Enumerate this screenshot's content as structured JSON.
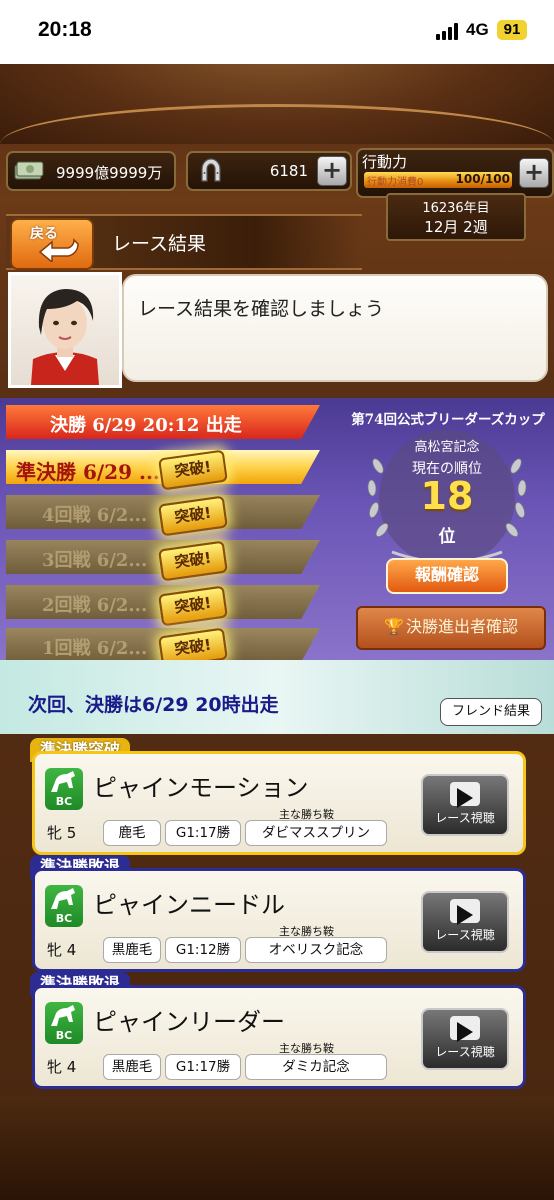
{
  "status": {
    "time": "20:18",
    "network": "4G",
    "battery": "91"
  },
  "resources": {
    "money": "9999億9999万",
    "horseshoe": "6181",
    "energy_label": "行動力",
    "energy_sub": "行動力消費0",
    "energy_value": "100/100"
  },
  "game_date": {
    "year": "16236年目",
    "week": "12月 2週"
  },
  "header": {
    "back_label": "戻る",
    "title": "レース結果"
  },
  "advisor": {
    "message": "レース結果を確認しましょう"
  },
  "tournament": {
    "rounds": [
      {
        "label": "決勝 6/29 20:12 出走",
        "state": "current"
      },
      {
        "label": "準決勝 6/29 ... 出走",
        "state": "cleared",
        "badge": "突破!"
      },
      {
        "label": "4回戦 6/2...",
        "state": "cleared",
        "badge": "突破!"
      },
      {
        "label": "3回戦 6/2...",
        "state": "cleared",
        "badge": "突破!"
      },
      {
        "label": "2回戦 6/2...",
        "state": "cleared",
        "badge": "突破!"
      },
      {
        "label": "1回戦 6/2...",
        "state": "cleared",
        "badge": "突破!"
      }
    ],
    "cup_title": "第74回公式ブリーダーズカップ",
    "cup_name": "高松宮記念",
    "rank_label": "現在の順位",
    "rank": "18",
    "rank_unit": "位",
    "reward_button": "報酬確認",
    "finalist_button": "決勝進出者確認"
  },
  "next_race": {
    "text": "次回、決勝は6/29 20時出走",
    "friend_button": "フレンド結果"
  },
  "horses": [
    {
      "status": "準決勝突破",
      "name": "ピャインモーション",
      "sex": "牝",
      "age": "5",
      "coat": "鹿毛",
      "record": "G1:17勝",
      "wins_label": "主な勝ち鞍",
      "main_win": "ダビマススプリン",
      "watch": "レース視聴",
      "icon_label": "BC"
    },
    {
      "status": "準決勝敗退",
      "name": "ピャインニードル",
      "sex": "牝",
      "age": "4",
      "coat": "黒鹿毛",
      "record": "G1:12勝",
      "wins_label": "主な勝ち鞍",
      "main_win": "オベリスク記念",
      "watch": "レース視聴",
      "icon_label": "BC"
    },
    {
      "status": "準決勝敗退",
      "name": "ピャインリーダー",
      "sex": "牝",
      "age": "4",
      "coat": "黒鹿毛",
      "record": "G1:17勝",
      "wins_label": "主な勝ち鞍",
      "main_win": "ダミカ記念",
      "watch": "レース視聴",
      "icon_label": "BC"
    }
  ],
  "colors": {
    "accent_orange": "#e25a10",
    "panel_purple": "#6a55b6",
    "gold": "#f5c518",
    "navy": "#2c2c92",
    "rank_yellow": "#ffe04a"
  }
}
